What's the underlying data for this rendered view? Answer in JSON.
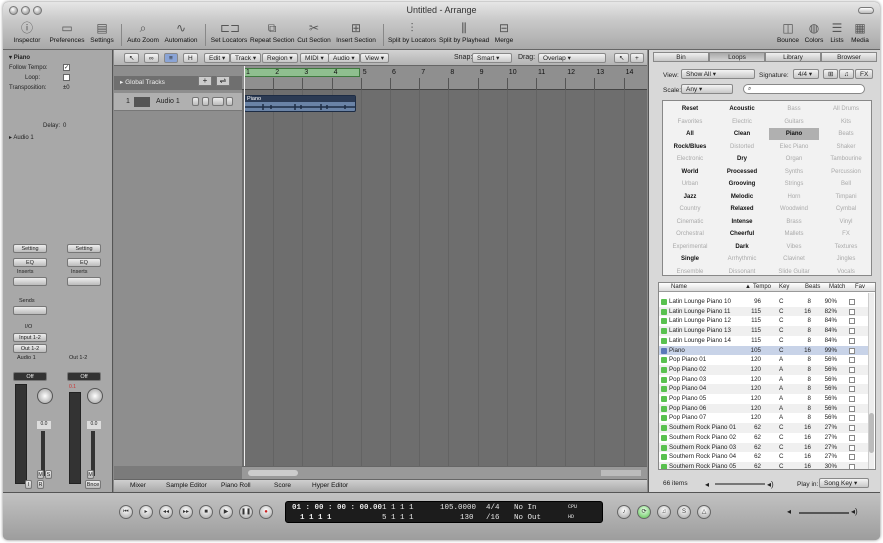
{
  "window": {
    "title": "Untitled - Arrange"
  },
  "toolbar": {
    "items": [
      "Inspector",
      "Preferences",
      "Settings",
      "Auto Zoom",
      "Automation",
      "Set Locators",
      "Repeat Section",
      "Cut Section",
      "Insert Section",
      "Split by Locators",
      "Split by Playhead",
      "Merge",
      "Bounce",
      "Colors",
      "Lists",
      "Media"
    ]
  },
  "inspector": {
    "region_title": "Piano",
    "follow_tempo": "Follow Tempo:",
    "loop": "Loop:",
    "transposition": "Transposition:",
    "transposition_value": "±0",
    "delay": "Delay:",
    "delay_value": "0",
    "audio_section": "Audio 1",
    "setting": "Setting",
    "eq": "EQ",
    "inserts": "Inserts",
    "sends": "Sends",
    "io": "I/O",
    "input": "Input 1-2",
    "output": "Out 1-2",
    "ch1_name": "Audio 1",
    "ch2_name": "Out 1-2",
    "off": "Off",
    "vol1": "0.0",
    "vol2": "0.0",
    "meter2": "0.1",
    "m": "M",
    "s": "S",
    "i": "I",
    "r": "R",
    "bnce": "Bnce"
  },
  "arrange": {
    "menus": [
      "Edit",
      "Track",
      "Region",
      "MIDI",
      "Audio",
      "View"
    ],
    "snap_label": "Snap:",
    "snap_value": "Smart",
    "drag_label": "Drag:",
    "drag_value": "Overlap",
    "global_tracks": "Global Tracks",
    "track_number": "1",
    "track_name": "Audio 1",
    "region_name": "Piano",
    "ruler": [
      "1",
      "2",
      "3",
      "4",
      "5",
      "6",
      "7",
      "8",
      "9",
      "10",
      "11",
      "12",
      "13",
      "14"
    ]
  },
  "edit_tabs": [
    "Mixer",
    "Sample Editor",
    "Piano Roll",
    "Score",
    "Hyper Editor"
  ],
  "media": {
    "tabs": [
      "Bin",
      "Loops",
      "Library",
      "Browser"
    ],
    "view_label": "View:",
    "view_value": "Show All",
    "signature_label": "Signature:",
    "signature_value": "4/4",
    "scale_label": "Scale:",
    "scale_value": "Any",
    "keywords": [
      [
        "Reset",
        "Acoustic",
        "Bass",
        "All Drums"
      ],
      [
        "Favorites",
        "Electric",
        "Guitars",
        "Kits"
      ],
      [
        "All",
        "Clean",
        "Piano",
        "Beats"
      ],
      [
        "Rock/Blues",
        "Distorted",
        "Elec Piano",
        "Shaker"
      ],
      [
        "Electronic",
        "Dry",
        "Organ",
        "Tambourine"
      ],
      [
        "World",
        "Processed",
        "Synths",
        "Percussion"
      ],
      [
        "Urban",
        "Grooving",
        "Strings",
        "Bell"
      ],
      [
        "Jazz",
        "Melodic",
        "Horn",
        "Timpani"
      ],
      [
        "Country",
        "Relaxed",
        "Woodwind",
        "Cymbal"
      ],
      [
        "Cinematic",
        "Intense",
        "Brass",
        "Vinyl"
      ],
      [
        "Orchestral",
        "Cheerful",
        "Mallets",
        "FX"
      ],
      [
        "Experimental",
        "Dark",
        "Vibes",
        "Textures"
      ],
      [
        "Single",
        "Arrhythmic",
        "Clavinet",
        "Jingles"
      ],
      [
        "Ensemble",
        "Dissonant",
        "Slide Guitar",
        "Vocals"
      ]
    ],
    "columns": [
      "Name",
      "Tempo",
      "Key",
      "Beats",
      "Match",
      "Fav"
    ],
    "rows": [
      [
        "Latin Lounge Piano 10",
        "96",
        "C",
        "8",
        "90%"
      ],
      [
        "Latin Lounge Piano 11",
        "115",
        "C",
        "16",
        "82%"
      ],
      [
        "Latin Lounge Piano 12",
        "115",
        "C",
        "8",
        "84%"
      ],
      [
        "Latin Lounge Piano 13",
        "115",
        "C",
        "8",
        "84%"
      ],
      [
        "Latin Lounge Piano 14",
        "115",
        "C",
        "8",
        "84%"
      ],
      [
        "Piano",
        "105",
        "C",
        "16",
        "99%"
      ],
      [
        "Pop Piano 01",
        "120",
        "A",
        "8",
        "56%"
      ],
      [
        "Pop Piano 02",
        "120",
        "A",
        "8",
        "56%"
      ],
      [
        "Pop Piano 03",
        "120",
        "A",
        "8",
        "56%"
      ],
      [
        "Pop Piano 04",
        "120",
        "A",
        "8",
        "56%"
      ],
      [
        "Pop Piano 05",
        "120",
        "A",
        "8",
        "56%"
      ],
      [
        "Pop Piano 06",
        "120",
        "A",
        "8",
        "56%"
      ],
      [
        "Pop Piano 07",
        "120",
        "A",
        "8",
        "56%"
      ],
      [
        "Southern Rock Piano 01",
        "62",
        "C",
        "16",
        "27%"
      ],
      [
        "Southern Rock Piano 02",
        "62",
        "C",
        "16",
        "27%"
      ],
      [
        "Southern Rock Piano 03",
        "62",
        "C",
        "16",
        "27%"
      ],
      [
        "Southern Rock Piano 04",
        "62",
        "C",
        "16",
        "27%"
      ],
      [
        "Southern Rock Piano 05",
        "62",
        "C",
        "16",
        "30%"
      ]
    ],
    "item_count": "66 items",
    "play_in_label": "Play in:",
    "play_in_value": "Song Key"
  },
  "transport": {
    "smpte": "01 : 00 : 00 : 00.00",
    "bars": "1   1   1     1",
    "pos1": "1   1   1   1",
    "pos2": "5   1   1   1",
    "tempo": "105.0000",
    "tempo2": "130",
    "sig": "4/4",
    "div": "/16",
    "in": "No In",
    "out": "No Out",
    "cpu": "CPU",
    "hd": "HD"
  },
  "colors": {
    "accent": "#59c14f",
    "region": "#6a83a6",
    "cycle": "#8fbf8f"
  }
}
